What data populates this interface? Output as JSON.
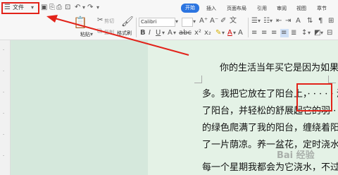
{
  "titlebar": {
    "file_menu": "文件",
    "tabs": [
      "开始",
      "插入",
      "页面布局",
      "引用",
      "审阅",
      "视图",
      "章节"
    ]
  },
  "ribbon": {
    "cut_label": "剪切",
    "paste_label": "粘贴",
    "copy_label": "复制",
    "format_painter_label": "格式刷",
    "font_name": "Calibri"
  },
  "document": {
    "lines": [
      "你的生活当年买它是因为如果",
      "多。我把它放在了阳台上，· · · · · 浇",
      "了阳台，并轻松的舒展起它的羽 · 翼",
      "的绿色爬满了我的阳台，缠绕着阳台",
      "了一片荫凉。养一盆花，定时浇水，",
      "每一个星期我都会为它浇水，不过，"
    ]
  },
  "watermark": "Bai 经验",
  "colors": {
    "accent": "#2b74e0",
    "annotation": "#e2231a",
    "page_bg": "#e4f2e6"
  }
}
